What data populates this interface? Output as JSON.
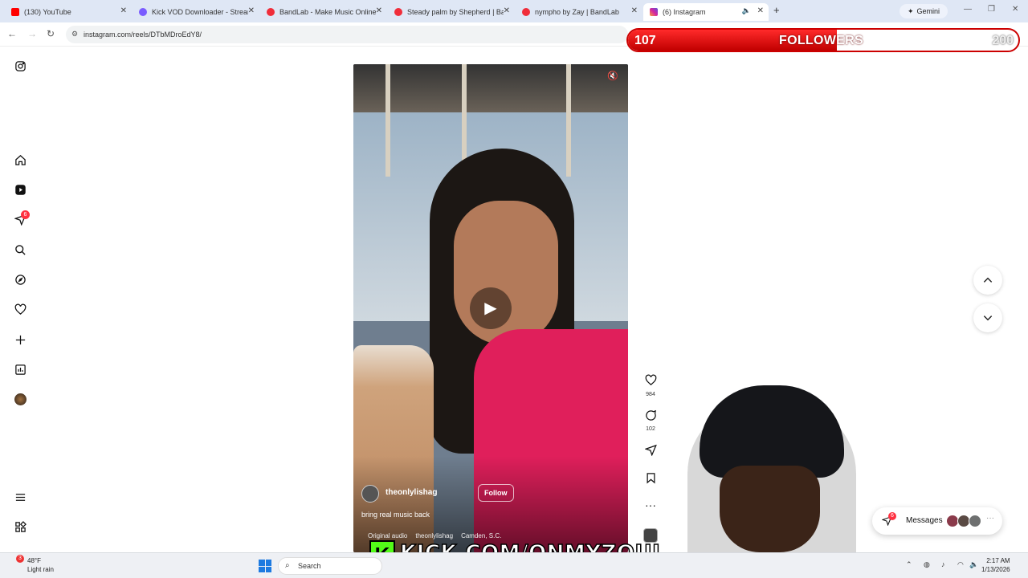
{
  "browser": {
    "tabs": [
      {
        "title": "(130) YouTube",
        "icon": "youtube-icon",
        "color": "#ff0000"
      },
      {
        "title": "Kick VOD Downloader - Stream",
        "icon": "kick-icon",
        "color": "#7a5cff"
      },
      {
        "title": "BandLab - Make Music Online",
        "icon": "bandlab-icon",
        "color": "#f02d3a"
      },
      {
        "title": "Steady palm by Shepherd | Ban",
        "icon": "bandlab-icon",
        "color": "#f02d3a"
      },
      {
        "title": "nympho by Zay | BandLab",
        "icon": "bandlab-icon",
        "color": "#f02d3a"
      },
      {
        "title": "(6) Instagram",
        "icon": "instagram-icon",
        "color": "#d6249f"
      }
    ],
    "gemini_label": "Gemini",
    "url": "instagram.com/reels/DTbMDroEdY8/"
  },
  "stream_overlay": {
    "followers_current": "107",
    "followers_label": "FOLLOWERS",
    "followers_goal": "200",
    "followers_progress": 0.535,
    "kick_letter": "K",
    "kick_url": "KICK.COM/ONMYZOUL"
  },
  "sidebar": {
    "notification_count": "6"
  },
  "reel": {
    "username": "theonlylishag",
    "follow_label": "Follow",
    "caption": "bring real music back",
    "audio": "Original audio",
    "audio_user": "theonlylishag",
    "location": "Camden, S.C."
  },
  "actions": {
    "likes": "984",
    "comments": "102"
  },
  "messages": {
    "label": "Messages",
    "badge": "6"
  },
  "taskbar": {
    "temperature": "48°F",
    "weather": "Light rain",
    "weather_badge": "3",
    "search_placeholder": "Search",
    "time": "2:17 AM",
    "date": "1/13/2026"
  }
}
